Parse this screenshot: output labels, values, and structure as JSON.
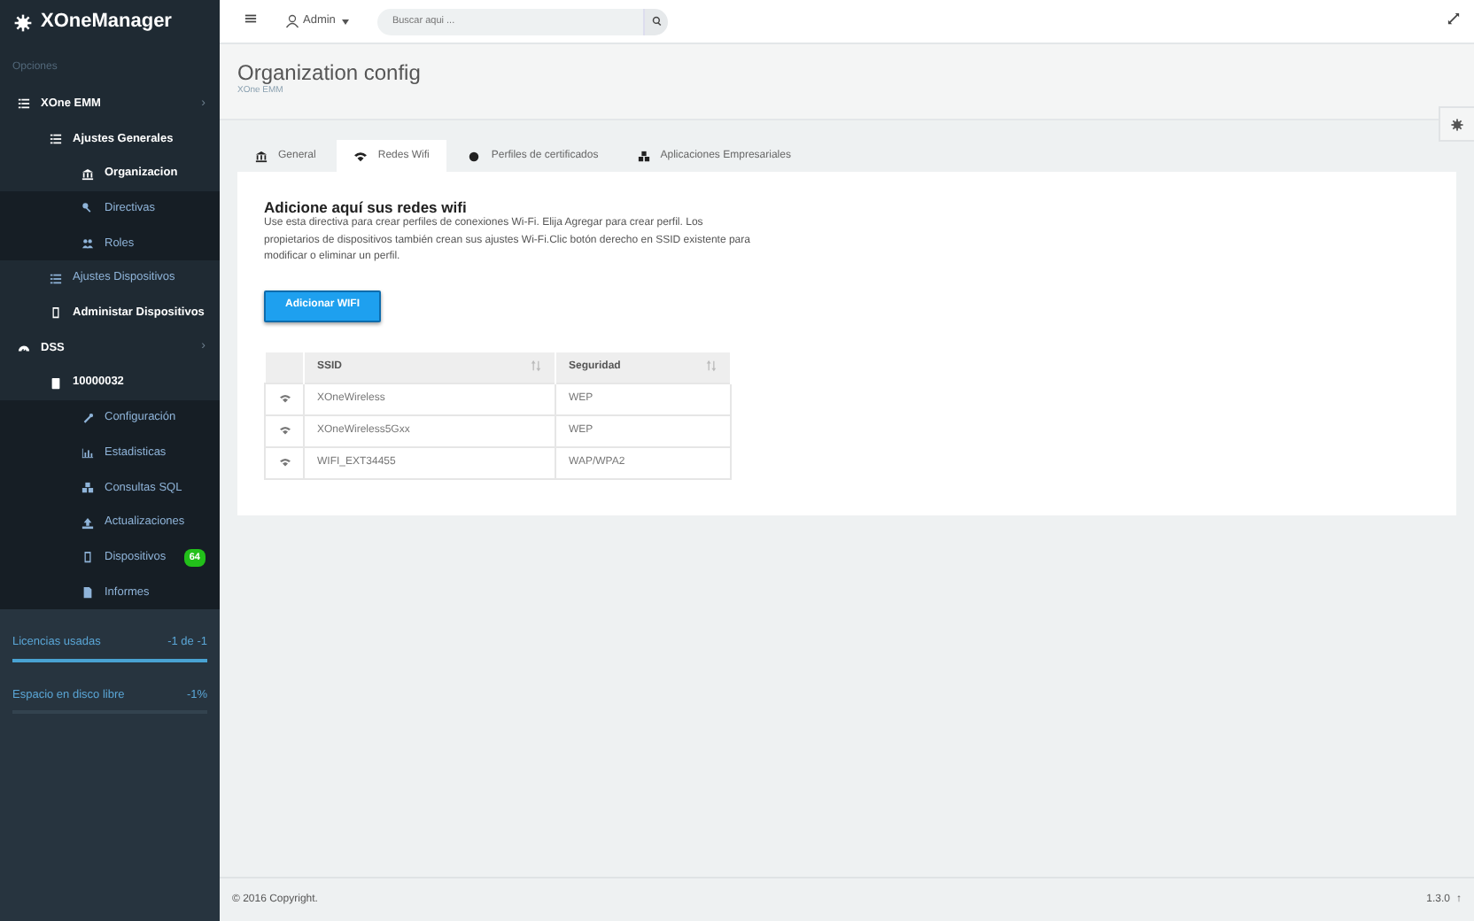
{
  "brand": "XOneManager",
  "sidebar": {
    "heading": "Opciones",
    "items": [
      {
        "label": "XOne EMM",
        "kind": "list",
        "active": true,
        "arrow": "›",
        "children": [
          {
            "label": "Ajustes Generales",
            "kind": "list",
            "active": true,
            "children": [
              {
                "label": "Organizacion",
                "kind": "bank",
                "active": true,
                "selected": true
              },
              {
                "label": "Directivas",
                "kind": "key",
                "active": false,
                "selected": false
              },
              {
                "label": "Roles",
                "kind": "users",
                "active": false,
                "selected": false
              }
            ]
          },
          {
            "label": "Ajustes Dispositivos",
            "kind": "list",
            "active": false
          },
          {
            "label": "Administar Dispositivos",
            "kind": "phone",
            "active": true
          }
        ]
      },
      {
        "label": "DSS",
        "kind": "gauge",
        "active": true,
        "arrow": "›",
        "children": [
          {
            "label": "10000032",
            "kind": "server",
            "active": true,
            "children": [
              {
                "label": "Configuración",
                "kind": "wrench",
                "active": false,
                "selected": false
              },
              {
                "label": "Estadisticas",
                "kind": "chart",
                "active": false,
                "selected": false
              },
              {
                "label": "Consultas SQL",
                "kind": "cubes",
                "active": false,
                "selected": false
              },
              {
                "label": "Actualizaciones",
                "kind": "upload",
                "active": false,
                "selected": false
              },
              {
                "label": "Dispositivos",
                "kind": "phone",
                "active": false,
                "selected": false,
                "badge": "64"
              },
              {
                "label": "Informes",
                "kind": "file",
                "active": false,
                "selected": false
              }
            ]
          }
        ]
      }
    ],
    "stats": [
      {
        "label": "Licencias usadas",
        "value": "-1 de -1",
        "level": 1
      },
      {
        "label": "Espacio en disco libre",
        "value": "-1%",
        "level": 0
      }
    ]
  },
  "topbar": {
    "user": "Admin",
    "search_placeholder": "Buscar aqui ..."
  },
  "page": {
    "title": "Organization config",
    "subtitle": "XOne EMM"
  },
  "tabs": [
    {
      "label": "General",
      "kind": "bank",
      "selected": false
    },
    {
      "label": "Redes Wifi",
      "kind": "wifi",
      "selected": true
    },
    {
      "label": "Perfiles de certificados",
      "kind": "dot",
      "selected": false
    },
    {
      "label": "Aplicaciones Empresariales",
      "kind": "cubes",
      "selected": false
    }
  ],
  "panel": {
    "heading": "Adicione aquí sus redes wifi",
    "description": "Use esta directiva para crear perfiles de conexiones Wi-Fi. Elija Agregar para crear perfil. Los propietarios de dispositivos también crean sus ajustes Wi-Fi.Clic botón derecho en SSID existente para modificar o eliminar un perfil.",
    "button": "Adicionar WIFI",
    "table": {
      "columns": [
        "SSID",
        "Seguridad"
      ],
      "rows": [
        {
          "ssid": "XOneWireless",
          "security": "WEP"
        },
        {
          "ssid": "XOneWireless5Gxx",
          "security": "WEP"
        },
        {
          "ssid": "WIFI_EXT34455",
          "security": "WAP/WPA2"
        }
      ]
    }
  },
  "footer": {
    "copyright": "© 2016 Copyright.",
    "version": "1.3.0",
    "up": "↑"
  }
}
